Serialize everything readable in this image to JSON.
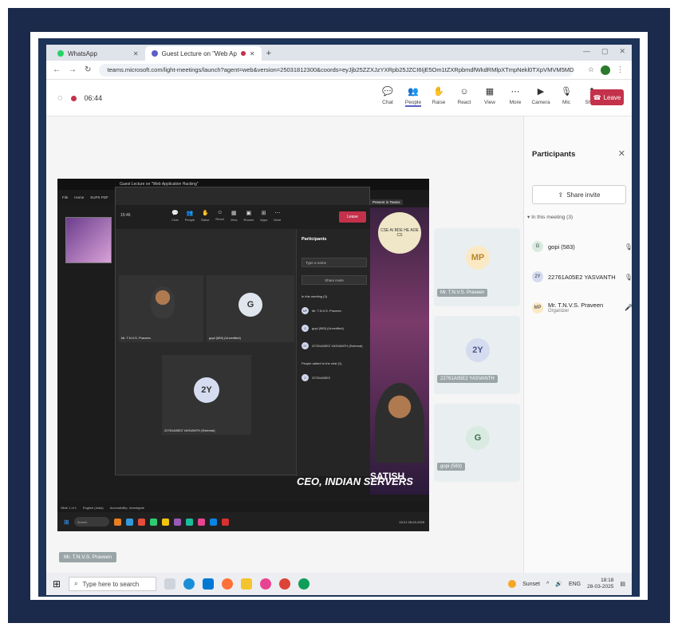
{
  "browser": {
    "tabs": [
      {
        "label": "WhatsApp",
        "color": "#25d366"
      },
      {
        "label": "Guest Lecture on \"Web Ap",
        "color": "#5b5fc7"
      }
    ],
    "new_tab": "+",
    "window_controls": [
      "—",
      "▢",
      "✕"
    ],
    "url": "teams.microsoft.com/light-meetings/launch?agent=web&version=25031812300&coords=eyJjb25ZZXJzYXRpb25JZCI6IjE5Om1tZXRpbmdfWkdRMlpXTmpNekl0TXpVMVM5MDBNR0tTFRnNU5EWXRNem..."
  },
  "teams": {
    "time": "06:44",
    "tools": [
      {
        "label": "Chat",
        "icon": "chat-icon",
        "glyph": "💬"
      },
      {
        "label": "People",
        "icon": "people-icon",
        "glyph": "👥",
        "badge": "3"
      },
      {
        "label": "Raise",
        "icon": "hand-icon",
        "glyph": "✋"
      },
      {
        "label": "React",
        "icon": "smile-icon",
        "glyph": "☺"
      },
      {
        "label": "View",
        "icon": "grid-icon",
        "glyph": "▦"
      },
      {
        "label": "More",
        "icon": "more-icon",
        "glyph": "⋯"
      },
      {
        "label": "Camera",
        "icon": "camera-off-icon",
        "glyph": "▶"
      },
      {
        "label": "Mic",
        "icon": "mic-off-icon",
        "glyph": "🎙"
      },
      {
        "label": "Share",
        "icon": "share-icon",
        "glyph": "⬆"
      }
    ],
    "leave_label": "Leave"
  },
  "panel": {
    "title": "Participants",
    "share_invite": "Share invite",
    "in_meeting": "In this meeting (3)",
    "participants": [
      {
        "initials": "G",
        "name": "gopi (583)",
        "role": "",
        "color": "#d9ebe0"
      },
      {
        "initials": "2Y",
        "name": "22761A05E2 YASVANTH",
        "role": "",
        "color": "#d6dcf0"
      },
      {
        "initials": "MP",
        "name": "Mr. T.N.V.S. Praveen",
        "role": "Organizer",
        "color": "#fbe9c4"
      }
    ]
  },
  "shared": {
    "menu": [
      "File",
      "Home",
      "SUPS PDF",
      "Insert"
    ],
    "inner_title": "Guest Lecture on \"Web Application Hacking\"",
    "inner_time": "15:46",
    "inner_tools": [
      "Chat",
      "People",
      "Raise",
      "React",
      "View",
      "Rooms",
      "Apps",
      "More"
    ],
    "inner_leave": "Leave",
    "tiles": [
      {
        "label": "Mr. T.N.V.S. Praveen",
        "initials": ""
      },
      {
        "label": "gopi (583) (Unverified)",
        "initials": "G"
      },
      {
        "label": "22761A05E2 YASVANTH (External)",
        "initials": "2Y"
      }
    ],
    "inner_panel": {
      "title": "Participants",
      "search": "Type a name",
      "share_invite": "Share invite",
      "in_meeting": "In this meeting (3)",
      "rows": [
        "Mr. T.N.V.S. Praveen",
        "gopi (583) (Unverified)",
        "22761A05E2 YASVANTH (External)"
      ],
      "added_label": "People added to the chat (1)",
      "added_row": "22761A05E2"
    },
    "present_label": "Present in Teams",
    "slide_logo": "CSE AI BDE HE AOE CS",
    "slide_name": "SATISH",
    "slide_ceo": "CEO, INDIAN SERVERS",
    "status_left": "Slide 1 of 1",
    "status_lang": "English (India)",
    "status_access": "Accessibility: Investigate",
    "search": "Search",
    "clock": "15:21\n28-03-2025"
  },
  "tiles": [
    {
      "initials": "MP",
      "label": "Mr. T.N.V.S. Praveen",
      "color": "#fbe9c4"
    },
    {
      "initials": "2Y",
      "label": "22761A05E2 YASVANTH",
      "color": "#d6dcf0"
    },
    {
      "initials": "G",
      "label": "gopi (583)",
      "color": "#d9ebe0"
    }
  ],
  "bottom_label": "Mr. T.N.V.S. Praveen",
  "taskbar": {
    "search_placeholder": "Type here to search",
    "weather": "Sunset",
    "lang": "ENG",
    "time": "18:18",
    "date": "28-03-2025"
  }
}
